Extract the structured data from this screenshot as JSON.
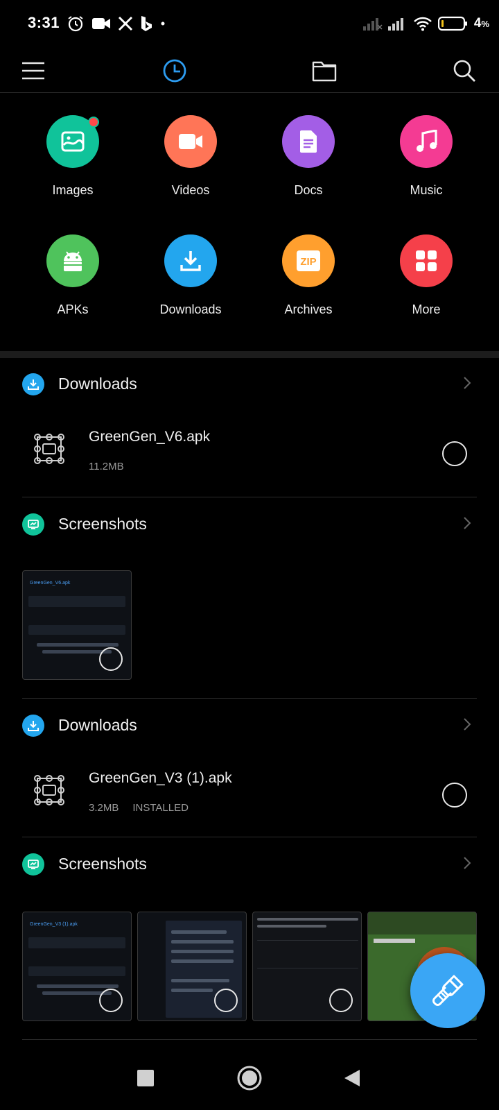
{
  "status_bar": {
    "time": "3:31",
    "battery_percent": "4",
    "battery_unit": "%",
    "icons": [
      "alarm-icon",
      "video-call-icon",
      "x-app-icon",
      "bing-icon",
      "dot-icon",
      "signal-icon",
      "wifi-icon",
      "battery-icon"
    ]
  },
  "toolbar": {
    "items": [
      "menu-icon",
      "recent-clock-icon",
      "folder-icon",
      "search-icon"
    ],
    "active_color": "#2d9cf0"
  },
  "categories": [
    {
      "label": "Images",
      "color": "#10c39a",
      "icon": "image-icon",
      "badge": true
    },
    {
      "label": "Videos",
      "color": "#ff7557",
      "icon": "video-icon"
    },
    {
      "label": "Docs",
      "color": "#a35ee6",
      "icon": "doc-icon"
    },
    {
      "label": "Music",
      "color": "#f43b93",
      "icon": "music-icon"
    },
    {
      "label": "APKs",
      "color": "#4fc35c",
      "icon": "android-icon"
    },
    {
      "label": "Downloads",
      "color": "#23a6ee",
      "icon": "download-icon"
    },
    {
      "label": "Archives",
      "color": "#ff9f2e",
      "icon": "zip-icon",
      "icon_text": "ZIP"
    },
    {
      "label": "More",
      "color": "#f5404a",
      "icon": "grid-icon"
    }
  ],
  "sections": [
    {
      "type": "downloads",
      "title": "Downloads",
      "icon_color": "#23a6ee",
      "file": {
        "name": "GreenGen_V6.apk",
        "size": "11.2MB",
        "status": ""
      }
    },
    {
      "type": "screenshots",
      "title": "Screenshots",
      "icon_color": "#10c39a",
      "thumbnails": [
        {
          "caption": "GreenGen_V6.apk"
        }
      ]
    },
    {
      "type": "downloads",
      "title": "Downloads",
      "icon_color": "#23a6ee",
      "file": {
        "name": "GreenGen_V3 (1).apk",
        "size": "3.2MB",
        "status": "INSTALLED"
      }
    },
    {
      "type": "screenshots",
      "title": "Screenshots",
      "icon_color": "#10c39a",
      "thumbnails": [
        {
          "caption": "GreenGen_V3 (1).apk"
        },
        {
          "caption": ""
        },
        {
          "caption": ""
        },
        {
          "caption": ""
        }
      ]
    }
  ],
  "fab": {
    "icon": "broom-clean-icon",
    "color": "#3aa6f5"
  },
  "nav_bar": {
    "items": [
      "recents-square-icon",
      "home-circle-icon",
      "back-triangle-icon"
    ]
  }
}
